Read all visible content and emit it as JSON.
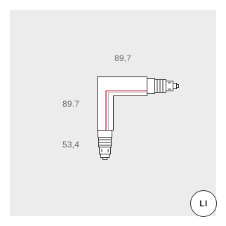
{
  "dimensions": {
    "top": "89,7",
    "left": "89.7",
    "bottom": "53,4"
  },
  "badge": {
    "label": "LI"
  },
  "colors": {
    "panel": "#ececec",
    "outline": "#2b2b2b",
    "accent_line": "#c0203a",
    "dimension_text": "#6b6b6b"
  }
}
